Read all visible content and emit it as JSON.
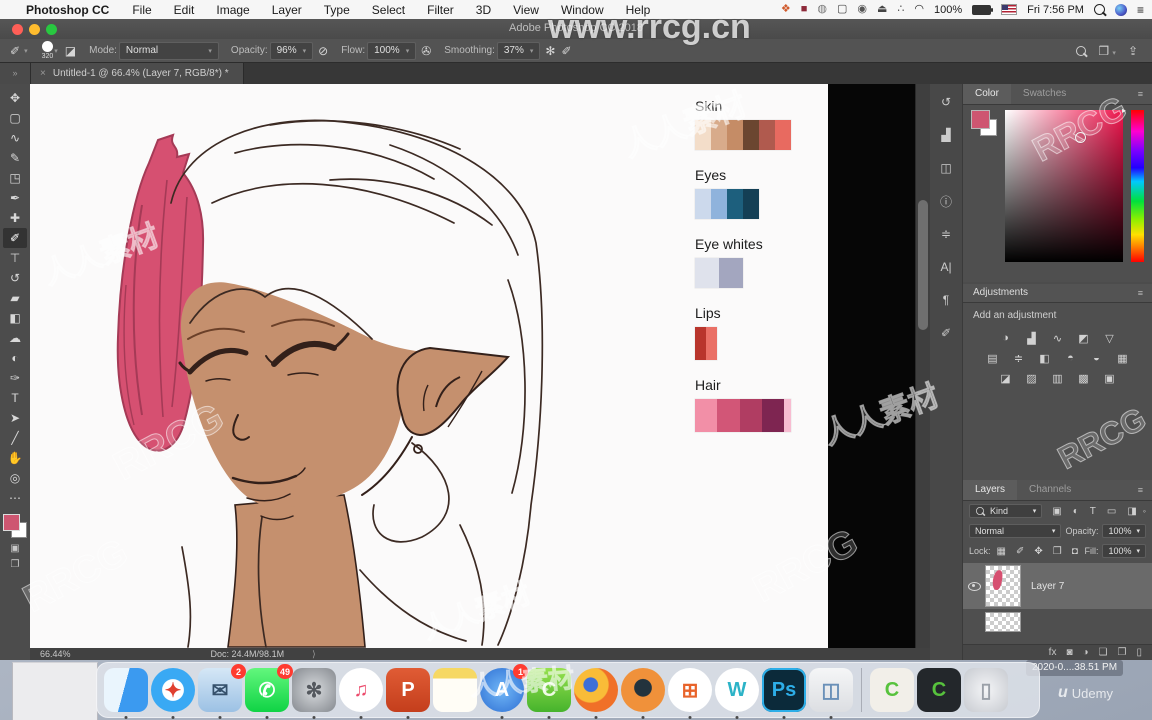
{
  "menu_bar": {
    "apple": "",
    "app_name": "Photoshop CC",
    "menus": [
      "File",
      "Edit",
      "Image",
      "Layer",
      "Type",
      "Select",
      "Filter",
      "3D",
      "View",
      "Window",
      "Help"
    ],
    "status_icons": [
      {
        "name": "app-grid-icon",
        "glyph": "❖",
        "color": "#d05a2c"
      },
      {
        "name": "red-app-icon",
        "glyph": "■",
        "color": "#8e2a3a"
      },
      {
        "name": "sync-icon",
        "glyph": "◍",
        "color": "#777777"
      },
      {
        "name": "display-icon",
        "glyph": "▢",
        "color": "#444444"
      },
      {
        "name": "record-icon",
        "glyph": "◉",
        "color": "#555555"
      },
      {
        "name": "airplay-icon",
        "glyph": "⏏",
        "color": "#444444"
      },
      {
        "name": "drag-dots-icon",
        "glyph": "∴",
        "color": "#555555"
      },
      {
        "name": "wifi-icon",
        "glyph": "◠",
        "color": "#222222"
      }
    ],
    "battery_pct": "100%",
    "time": "Fri 7:56 PM"
  },
  "window": {
    "title": "Adobe Photoshop CC 2018",
    "document_tab": "Untitled-1 @ 66.4% (Layer 7, RGB/8*) *",
    "tab_close": "×",
    "toolbar_collapse": "»",
    "status_zoom": "66.44%",
    "status_doc": "Doc: 24.4M/98.1M",
    "status_chevron": "⟩"
  },
  "options_bar": {
    "brush_size": "320",
    "mode_label": "Mode:",
    "mode_value": "Normal",
    "opacity_label": "Opacity:",
    "opacity_value": "96%",
    "flow_label": "Flow:",
    "flow_value": "100%",
    "smoothing_label": "Smoothing:",
    "smoothing_value": "37%"
  },
  "toolbar": {
    "selected_index": 7,
    "foreground_color": "#ce5671",
    "background_color": "#ffffff",
    "tools": [
      {
        "name": "move",
        "glyph": "✥"
      },
      {
        "name": "marquee",
        "glyph": "▢"
      },
      {
        "name": "lasso",
        "glyph": "∿"
      },
      {
        "name": "quick-selection",
        "glyph": "✎"
      },
      {
        "name": "crop",
        "glyph": "◳"
      },
      {
        "name": "eyedropper",
        "glyph": "✒"
      },
      {
        "name": "spot-healing",
        "glyph": "✚"
      },
      {
        "name": "brush",
        "glyph": "✐"
      },
      {
        "name": "clone-stamp",
        "glyph": "⊤"
      },
      {
        "name": "history-brush",
        "glyph": "↺"
      },
      {
        "name": "eraser",
        "glyph": "▰"
      },
      {
        "name": "gradient",
        "glyph": "◧"
      },
      {
        "name": "smudge",
        "glyph": "☁"
      },
      {
        "name": "dodge",
        "glyph": "◐"
      },
      {
        "name": "pen",
        "glyph": "✑"
      },
      {
        "name": "type",
        "glyph": "T"
      },
      {
        "name": "path-selection",
        "glyph": "➤"
      },
      {
        "name": "line",
        "glyph": "╱"
      },
      {
        "name": "hand",
        "glyph": "✋"
      },
      {
        "name": "zoom",
        "glyph": "◎"
      },
      {
        "name": "more",
        "glyph": "⋯"
      }
    ]
  },
  "canvas": {
    "palette": [
      {
        "label": "Skin",
        "colors": [
          "#f3ddc9",
          "#d8ab8b",
          "#c58c66",
          "#6b4630",
          "#b05a4e",
          "#e86a60"
        ]
      },
      {
        "label": "Eyes",
        "colors": [
          "#ccd9ec",
          "#8fb3dc",
          "#1d5f7d",
          "#143f55"
        ]
      },
      {
        "label": "Eye whites",
        "colors": [
          "#dfe2ec",
          "#a3a6bf"
        ]
      },
      {
        "label": "Lips",
        "colors": [
          "#b9352c",
          "#ea7066"
        ]
      },
      {
        "label": "Hair",
        "colors": [
          "#f28fa7",
          "#d25677",
          "#b03d62",
          "#7e2551",
          "#f7bcd1"
        ]
      }
    ]
  },
  "panel_strip": {
    "icons": [
      {
        "name": "history-panel-icon",
        "glyph": "↺"
      },
      {
        "name": "histogram-panel-icon",
        "glyph": "▟"
      },
      {
        "name": "navigator-panel-icon",
        "glyph": "◫"
      },
      {
        "name": "info-panel-icon",
        "glyph": "ⓘ"
      },
      {
        "name": "properties-panel-icon",
        "glyph": "≑"
      },
      {
        "name": "character-panel-icon",
        "glyph": "A|"
      },
      {
        "name": "paragraph-panel-icon",
        "glyph": "¶"
      },
      {
        "name": "brush-settings-panel-icon",
        "glyph": "✐"
      }
    ]
  },
  "panels": {
    "color": {
      "tab_color": "Color",
      "tab_swatches": "Swatches",
      "menu_glyph": "≡",
      "hue_marker": "▸",
      "foreground_color": "#ce5671"
    },
    "adjustments": {
      "title": "Adjustments",
      "subtitle": "Add an adjustment",
      "menu_glyph": "≡",
      "rows": [
        [
          {
            "name": "brightness-contrast-icon",
            "glyph": "◑"
          },
          {
            "name": "levels-icon",
            "glyph": "▟"
          },
          {
            "name": "curves-icon",
            "glyph": "∿"
          },
          {
            "name": "exposure-icon",
            "glyph": "◩"
          },
          {
            "name": "vibrance-icon",
            "glyph": "▽"
          }
        ],
        [
          {
            "name": "hue-saturation-icon",
            "glyph": "▤"
          },
          {
            "name": "color-balance-icon",
            "glyph": "≑"
          },
          {
            "name": "black-white-icon",
            "glyph": "◧"
          },
          {
            "name": "photo-filter-icon",
            "glyph": "◓"
          },
          {
            "name": "channel-mixer-icon",
            "glyph": "◒"
          },
          {
            "name": "color-lookup-icon",
            "glyph": "▦"
          }
        ],
        [
          {
            "name": "invert-icon",
            "glyph": "◪"
          },
          {
            "name": "posterize-icon",
            "glyph": "▨"
          },
          {
            "name": "threshold-icon",
            "glyph": "▥"
          },
          {
            "name": "gradient-map-icon",
            "glyph": "▩"
          },
          {
            "name": "selective-color-icon",
            "glyph": "▣"
          }
        ]
      ]
    },
    "layers": {
      "tab_layers": "Layers",
      "tab_channels": "Channels",
      "menu_glyph": "≡",
      "filter_label": "Kind",
      "filter_icons": [
        {
          "name": "filter-pixel-icon",
          "glyph": "▣"
        },
        {
          "name": "filter-adjustment-icon",
          "glyph": "◐"
        },
        {
          "name": "filter-type-icon",
          "glyph": "T"
        },
        {
          "name": "filter-shape-icon",
          "glyph": "▭"
        },
        {
          "name": "filter-smart-object-icon",
          "glyph": "◨"
        }
      ],
      "blend_mode": "Normal",
      "opacity_label": "Opacity:",
      "opacity_value": "100%",
      "lock_label": "Lock:",
      "lock_icons": [
        {
          "name": "lock-transparent-icon",
          "glyph": "▦"
        },
        {
          "name": "lock-pixels-icon",
          "glyph": "✐"
        },
        {
          "name": "lock-position-icon",
          "glyph": "✥"
        },
        {
          "name": "lock-artboard-icon",
          "glyph": "❐"
        },
        {
          "name": "lock-all-icon",
          "glyph": "◘"
        }
      ],
      "fill_label": "Fill:",
      "fill_value": "100%",
      "layer_name": "Layer 7",
      "bottom_icons": [
        {
          "name": "layer-style-icon",
          "glyph": "fx"
        },
        {
          "name": "layer-mask-icon",
          "glyph": "◙"
        },
        {
          "name": "new-adjustment-icon",
          "glyph": "◑"
        },
        {
          "name": "new-group-icon",
          "glyph": "❏"
        },
        {
          "name": "new-layer-icon",
          "glyph": "❐"
        },
        {
          "name": "delete-layer-icon",
          "glyph": "▯"
        }
      ]
    }
  },
  "dock": {
    "items": [
      {
        "name": "finder",
        "bg": "linear-gradient(105deg,#eaf5fd 0 46%,#3b9af0 46%)",
        "glyph": "",
        "fg": "#1a5fb0",
        "circle": false,
        "badge": null,
        "running": true
      },
      {
        "name": "safari",
        "bg": "radial-gradient(circle at 50% 50%,#ffffff 0 34%,#39a9f4 36% 72%,#1f8ae0 100%)",
        "glyph": "✦",
        "fg": "#e04030",
        "circle": true,
        "badge": null,
        "running": true
      },
      {
        "name": "mail",
        "bg": "linear-gradient(#d5e7f6,#9cc1e4)",
        "glyph": "✉",
        "fg": "#35506b",
        "circle": false,
        "badge": "2",
        "running": true
      },
      {
        "name": "facetime",
        "bg": "linear-gradient(#63f77d,#0fd345)",
        "glyph": "✆",
        "fg": "#ffffff",
        "circle": false,
        "badge": "49",
        "running": true
      },
      {
        "name": "system-preferences",
        "bg": "radial-gradient(#d8dbde,#85898f)",
        "glyph": "✻",
        "fg": "#55595f",
        "circle": false,
        "badge": null,
        "running": true
      },
      {
        "name": "itunes",
        "bg": "#ffffff",
        "glyph": "♫",
        "fg": "#ec4b6c",
        "circle": true,
        "badge": null,
        "running": true
      },
      {
        "name": "powerpoint",
        "bg": "linear-gradient(#e05c35,#c43e1c)",
        "glyph": "P",
        "fg": "#ffffff",
        "circle": false,
        "badge": null,
        "running": true
      },
      {
        "name": "notes",
        "bg": "linear-gradient(#f6d863 0 24%,#fffdf6 24%)",
        "glyph": "",
        "fg": "#888888",
        "circle": false,
        "badge": null,
        "running": false
      },
      {
        "name": "app-store",
        "bg": "radial-gradient(#71b7f7,#2e6fd3)",
        "glyph": "A",
        "fg": "#ffffff",
        "circle": true,
        "badge": "1",
        "running": true
      },
      {
        "name": "camtasia",
        "bg": "linear-gradient(#97e14f,#46b32c)",
        "glyph": "C",
        "fg": "#eefbe4",
        "circle": false,
        "badge": null,
        "running": true
      },
      {
        "name": "firefox",
        "bg": "radial-gradient(circle at 38% 38%,#3d6fd8 0 18%,#f9bc38 20% 45%,#f07028 48% 75%,#e0481f 100%)",
        "glyph": "",
        "fg": "#ffffff",
        "circle": true,
        "badge": null,
        "running": true
      },
      {
        "name": "orange-circle-app",
        "bg": "radial-gradient(circle at 50% 45%,#23333d 0 26%,#f0913a 28% 100%)",
        "glyph": "",
        "fg": "#ffffff",
        "circle": true,
        "badge": null,
        "running": true
      },
      {
        "name": "microsoft-autoupdate",
        "bg": "#ffffff",
        "glyph": "⊞",
        "fg": "#e8632a",
        "circle": true,
        "badge": null,
        "running": true
      },
      {
        "name": "wunderlist",
        "bg": "#ffffff",
        "glyph": "W",
        "fg": "#2cb3c7",
        "circle": true,
        "badge": null,
        "running": true
      },
      {
        "name": "photoshop",
        "bg": "#0b2a3a",
        "glyph": "Ps",
        "fg": "#2daee8",
        "circle": false,
        "badge": null,
        "running": true
      },
      {
        "name": "preview",
        "bg": "linear-gradient(#f5f6f7,#dcdee2)",
        "glyph": "◫",
        "fg": "#6a90b8",
        "circle": false,
        "badge": null,
        "running": true
      },
      {
        "name": "separator",
        "type": "sep"
      },
      {
        "name": "camtasia-project-file",
        "bg": "#f2efe9",
        "glyph": "C",
        "fg": "#57c23d",
        "circle": false,
        "badge": null,
        "running": false
      },
      {
        "name": "camtasia-video-file",
        "bg": "#23272b",
        "glyph": "C",
        "fg": "#57c23d",
        "circle": false,
        "badge": null,
        "running": false
      },
      {
        "name": "trash",
        "bg": "radial-gradient(#f4f5f7,#c7cad0)",
        "glyph": "▯",
        "fg": "#9aa0a8",
        "circle": false,
        "badge": null,
        "running": false
      }
    ]
  },
  "desktop": {
    "file_label": "2020-0....38.51 PM"
  },
  "watermarks": {
    "cn": "人人素材",
    "en": "RRCG",
    "url": "www.rrcg.cn",
    "udemy": "Udemy",
    "udemy_logo": "u"
  }
}
